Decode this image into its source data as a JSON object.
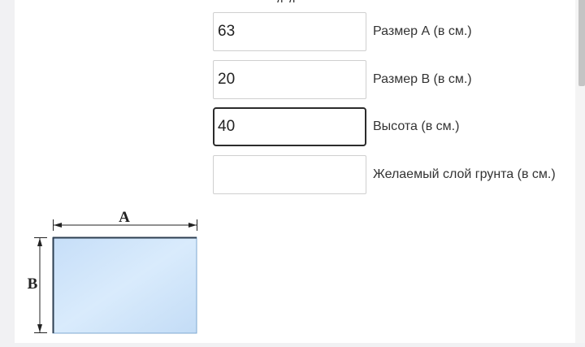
{
  "form": {
    "title_fragment": "д д",
    "fields": [
      {
        "value": "63",
        "placeholder": "",
        "label": "Размер А (в см.)"
      },
      {
        "value": "20",
        "placeholder": "",
        "label": "Размер В (в см.)"
      },
      {
        "value": "40",
        "placeholder": "",
        "label": "Высота (в см.)"
      },
      {
        "value": "",
        "placeholder": "",
        "label": "Желаемый слой грунта (в см.)"
      }
    ]
  },
  "diagram": {
    "label_a": "A",
    "label_b": "B",
    "fill_color": "#cfe6fb",
    "edge_color": "#2c3e50"
  }
}
